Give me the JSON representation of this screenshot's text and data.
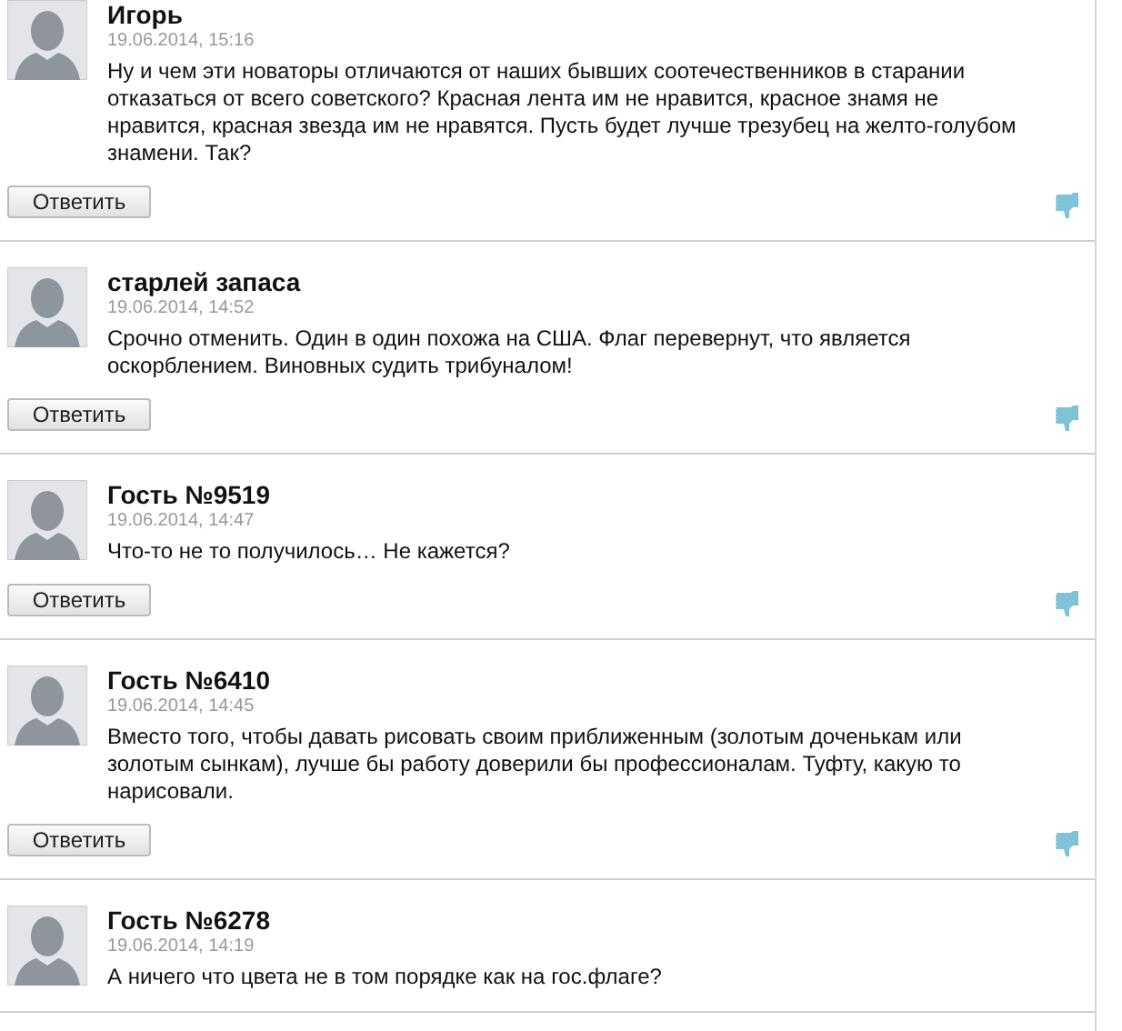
{
  "comments": [
    {
      "author": "Игорь",
      "date": "19.06.2014, 15:16",
      "text": "Ну и чем эти новаторы отличаются от наших бывших соотечественников в старании отказаться от всего советского? Красная лента им не нравится, красное знамя не нравится, красная звезда им не нравятся. Пусть будет лучше трезубец на желто-голубом знамени. Так?",
      "reply": "Ответить"
    },
    {
      "author": "старлей запаса",
      "date": "19.06.2014, 14:52",
      "text": "Срочно отменить. Один в один похожа на США. Флаг перевернут, что является оскорблением. Виновных судить трибуналом!",
      "reply": "Ответить"
    },
    {
      "author": "Гость №9519",
      "date": "19.06.2014, 14:47",
      "text": "Что-то не то получилось… Не кажется?",
      "reply": "Ответить"
    },
    {
      "author": "Гость №6410",
      "date": "19.06.2014, 14:45",
      "text": "Вместо того, чтобы давать рисовать своим приближенным (золотым доченькам или золотым сынкам), лучше бы работу доверили бы профессионалам. Туфту, какую то нарисовали.",
      "reply": "Ответить"
    },
    {
      "author": "Гость №6278",
      "date": "19.06.2014, 14:19",
      "text": "А ничего что цвета не в том порядке как на гос.флаге?"
    }
  ]
}
